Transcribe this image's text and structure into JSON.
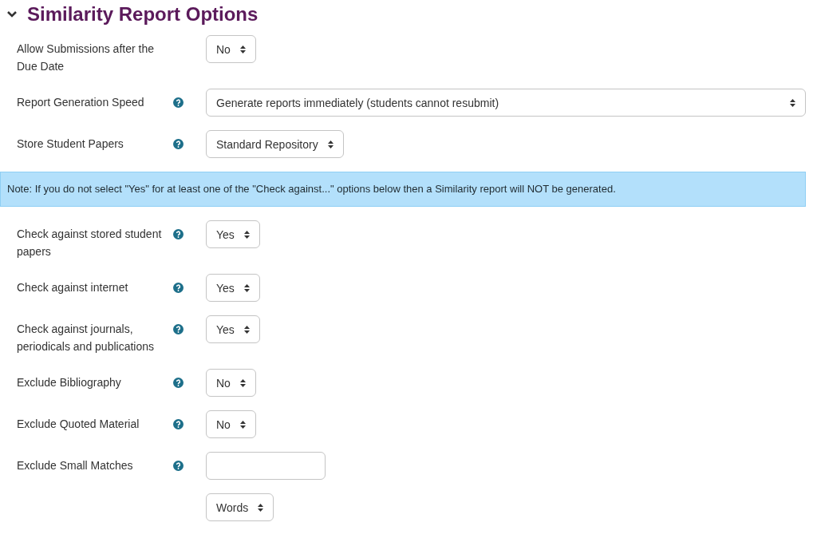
{
  "section": {
    "title": "Similarity Report Options",
    "expanded": true
  },
  "rows": [
    {
      "kind": "field",
      "label": "Allow Submissions after the Due Date",
      "help": false,
      "controls": [
        {
          "kind": "select",
          "value": "No"
        }
      ]
    },
    {
      "kind": "field",
      "label": "Report Generation Speed",
      "help": true,
      "controls": [
        {
          "kind": "select-wide",
          "value": "Generate reports immediately (students cannot resubmit)"
        }
      ]
    },
    {
      "kind": "field",
      "label": "Store Student Papers",
      "help": true,
      "controls": [
        {
          "kind": "select",
          "value": "Standard Repository"
        }
      ]
    },
    {
      "kind": "note",
      "text": "Note: If you do not select \"Yes\" for at least one of the \"Check against...\" options below then a Similarity report will NOT be generated."
    },
    {
      "kind": "field",
      "label": "Check against stored student papers",
      "help": true,
      "controls": [
        {
          "kind": "select",
          "value": "Yes"
        }
      ]
    },
    {
      "kind": "field",
      "label": "Check against internet",
      "help": true,
      "controls": [
        {
          "kind": "select",
          "value": "Yes"
        }
      ]
    },
    {
      "kind": "field",
      "label": "Check against journals, periodicals and publications",
      "help": true,
      "controls": [
        {
          "kind": "select",
          "value": "Yes"
        }
      ]
    },
    {
      "kind": "field",
      "label": "Exclude Bibliography",
      "help": true,
      "controls": [
        {
          "kind": "select",
          "value": "No"
        }
      ]
    },
    {
      "kind": "field",
      "label": "Exclude Quoted Material",
      "help": true,
      "controls": [
        {
          "kind": "select",
          "value": "No"
        }
      ]
    },
    {
      "kind": "field",
      "label": "Exclude Small Matches",
      "help": true,
      "controls": [
        {
          "kind": "text"
        },
        {
          "kind": "select",
          "value": "Words"
        }
      ]
    }
  ]
}
